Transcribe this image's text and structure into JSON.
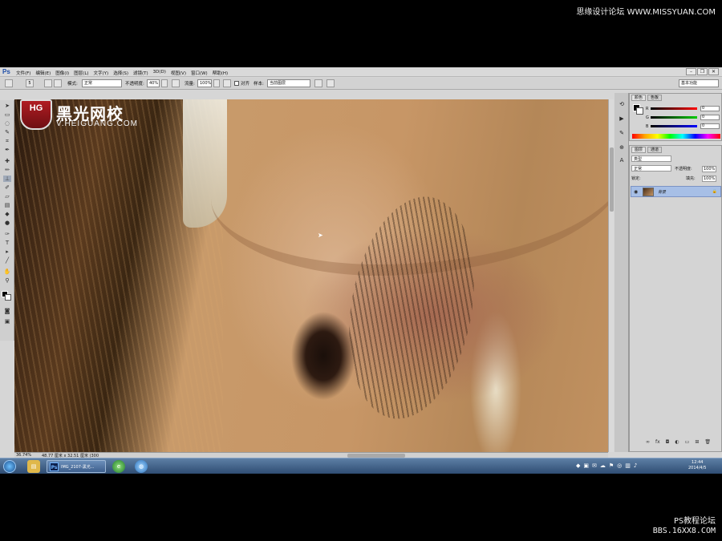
{
  "watermarks": {
    "top_right": "思缘设计论坛 WWW.MISSYUAN.COM",
    "bottom_line1": "PS教程论坛",
    "bottom_line2": "BBS.16XX8.COM"
  },
  "app": {
    "logo": "Ps",
    "menus": [
      "文件(F)",
      "编辑(E)",
      "图像(I)",
      "图层(L)",
      "文字(Y)",
      "选择(S)",
      "滤镜(T)",
      "3D(D)",
      "视图(V)",
      "窗口(W)",
      "帮助(H)"
    ]
  },
  "options": {
    "brush_size": "5",
    "mode_label": "模式:",
    "mode_value": "正常",
    "opacity_label": "不透明度:",
    "opacity_value": "40%",
    "flow_label": "流量:",
    "flow_value": "100%",
    "aligned_label": "对齐",
    "sample_label": "样本:",
    "sample_value": "当前图层",
    "workspace": "基本功能"
  },
  "canvas_logo": {
    "badge": "HG",
    "cn": "黑光网校",
    "url": "V.HEIGUANG.COM"
  },
  "status": {
    "zoom": "36.74%",
    "doc": "48.77 厘米 x 32.51 厘米 (300"
  },
  "color_panel": {
    "tab1": "颜色",
    "tab2": "色板",
    "channels": [
      {
        "name": "R",
        "value": "0"
      },
      {
        "name": "G",
        "value": "0"
      },
      {
        "name": "B",
        "value": "0"
      }
    ]
  },
  "layers_panel": {
    "tab1": "图层",
    "tab2": "通道",
    "kind": "类型",
    "blend": "正常",
    "opacity_label": "不透明度:",
    "opacity_value": "100%",
    "lock_label": "锁定:",
    "fill_label": "填充:",
    "fill_value": "100%",
    "layer_name": "背景"
  },
  "taskbar": {
    "ps_task": "IMG_2107-黑光...",
    "time": "12:44",
    "date": "2014/4/5"
  }
}
